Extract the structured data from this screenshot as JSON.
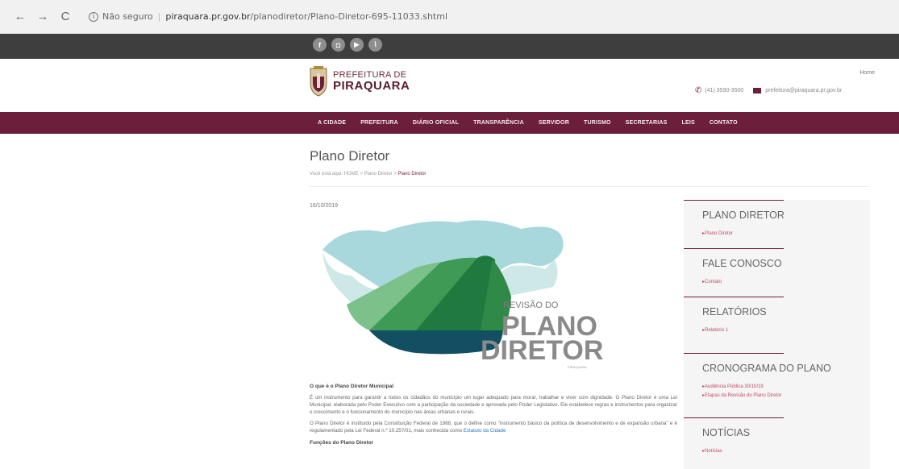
{
  "browser": {
    "nav_back": "←",
    "nav_forward": "→",
    "nav_reload": "C",
    "security_label": "Não seguro",
    "url_host": "piraquara.pr.gov.br",
    "url_path": "/planodiretor/Plano-Diretor-695-11033.shtml"
  },
  "social": {
    "facebook_glyph": "f",
    "instagram_glyph": "◘",
    "youtube_glyph": "▶",
    "rss_glyph": "⌇"
  },
  "header": {
    "logo_line1": "PREFEITURA DE",
    "logo_line2": "PIRAQUARA",
    "home_label": "Home",
    "phone": "(41) 3590-3500",
    "email": "prefeitura@piraquara.pr.gov.br"
  },
  "nav": {
    "items": [
      "A CIDADE",
      "PREFEITURA",
      "DIÁRIO OFICIAL",
      "TRANSPARÊNCIA",
      "SERVIDOR",
      "TURISMO",
      "SECRETARIAS",
      "LEIS",
      "CONTATO"
    ]
  },
  "page": {
    "title": "Plano Diretor",
    "breadcrumb_prefix": "Você está aqui: HOME > Plano Diretor > ",
    "breadcrumb_current": "Plano Diretor",
    "date": "16/10/2019"
  },
  "figure": {
    "line1": "REVISÃO DO",
    "line2": "PLANO",
    "line3": "DIRETOR",
    "badge": "PIRAQUARA"
  },
  "article": {
    "heading1": "O que é o Plano Diretor Municipal",
    "p1": "É um instrumento para garantir a todos os cidadãos do município um lugar adequado para morar, trabalhar e viver com dignidade. O Plano Diretor é uma Lei Municipal, elaborada pelo Poder Executivo com a participação da sociedade e aprovada pelo Poder Legislativo. Ele estabelece regras e instrumentos para organizar o crescimento e o funcionamento do município nas áreas urbanas e rurais.",
    "p2_text": "O Plano Diretor é instituído pela Constituição Federal de 1988, que o define como \"instrumento básico da política de desenvolvimento e de expansão urbana\" e é regulamentado pela Lei Federal n.º 10.257/01, mais conhecida como ",
    "p2_link": "Estatuto da Cidade",
    "heading2": "Funções do Plano Diretor"
  },
  "sidebar": {
    "sections": [
      {
        "title": "PLANO DIRETOR",
        "links": [
          "Plano Diretor"
        ]
      },
      {
        "title": "FALE CONOSCO",
        "links": [
          "Contato"
        ]
      },
      {
        "title": "RELATÓRIOS",
        "links": [
          "Relatório 1"
        ]
      },
      {
        "title": "CRONOGRAMA DO PLANO",
        "links": [
          "Audiência Pública 30/10/19",
          "Etapas da Revisão do Plano Diretor"
        ]
      },
      {
        "title": "NOTÍCIAS",
        "links": [
          "Notícias"
        ]
      }
    ]
  },
  "colors": {
    "brand": "#6b1f3a",
    "topbar": "#3e3e3e",
    "map_sky": "#a8d8dc",
    "map_green_dark": "#1e7a3e",
    "map_green_mid": "#3d9b55",
    "map_green_light": "#7cc08a",
    "map_water": "#124f63"
  }
}
